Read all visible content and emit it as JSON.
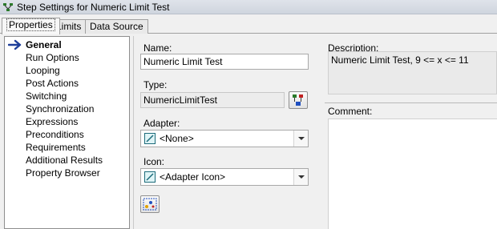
{
  "window": {
    "title": "Step Settings for Numeric Limit Test"
  },
  "tabs": [
    {
      "label": "Properties"
    },
    {
      "label": "Limits"
    },
    {
      "label": "Data Source"
    }
  ],
  "nav": {
    "selected": "General",
    "items": [
      {
        "label": "General"
      },
      {
        "label": "Run Options"
      },
      {
        "label": "Looping"
      },
      {
        "label": "Post Actions"
      },
      {
        "label": "Switching"
      },
      {
        "label": "Synchronization"
      },
      {
        "label": "Expressions"
      },
      {
        "label": "Preconditions"
      },
      {
        "label": "Requirements"
      },
      {
        "label": "Additional Results"
      },
      {
        "label": "Property Browser"
      }
    ]
  },
  "general": {
    "name_label": "Name:",
    "name_value": "Numeric Limit Test",
    "type_label": "Type:",
    "type_value": "NumericLimitTest",
    "adapter_label": "Adapter:",
    "adapter_value": "<None>",
    "icon_label": "Icon:",
    "icon_value": "<Adapter Icon>",
    "description_label": "Description:",
    "description_value": "Numeric Limit Test,  9 <= x <= 11",
    "comment_label": "Comment:"
  },
  "icons": {
    "title": "steps-icon",
    "nav_selected": "arrow-right-icon",
    "type_button": "edit-type-icon",
    "adapter": "adapter-icon",
    "icon_browse": "browse-icon"
  },
  "colors": {
    "accent": "#1f3f9a",
    "window_bg": "#f0f0f0"
  }
}
